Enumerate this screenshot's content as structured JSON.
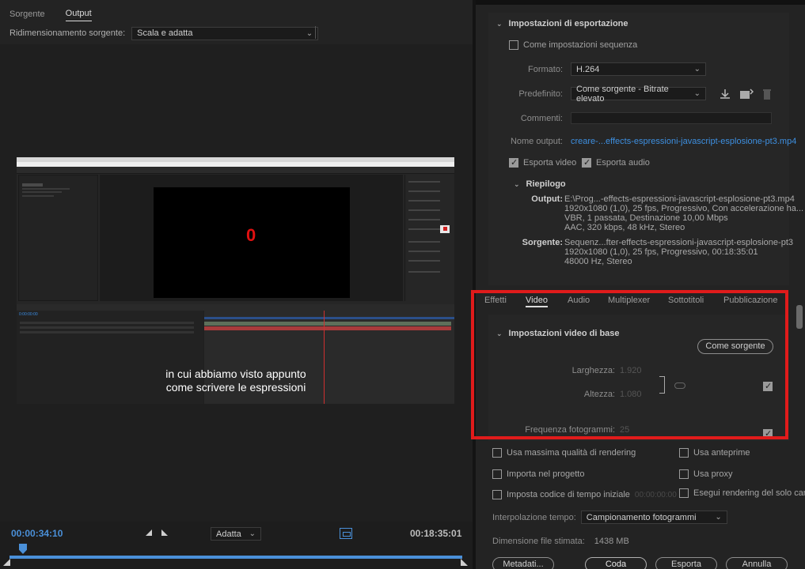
{
  "source_tabs": [
    {
      "label": "Sorgente",
      "active": false
    },
    {
      "label": "Output",
      "active": true
    }
  ],
  "resize": {
    "label": "Ridimensionamento sorgente:",
    "value": "Scala e adatta"
  },
  "preview": {
    "comp_value": "0",
    "timecode": "0:00:00:00",
    "subtitle_line1": "in cui abbiamo visto appunto",
    "subtitle_line2": "come scrivere le espressioni"
  },
  "playback": {
    "current_time": "00:00:34:10",
    "duration": "00:18:35:01",
    "fit_value": "Adatta"
  },
  "export": {
    "section_title": "Impostazioni di esportazione",
    "match_sequence_label": "Come impostazioni sequenza",
    "match_sequence_checked": false,
    "format_label": "Formato:",
    "format_value": "H.264",
    "preset_label": "Predefinito:",
    "preset_value": "Come sorgente - Bitrate elevato",
    "comments_label": "Commenti:",
    "comments_value": "",
    "output_name_label": "Nome output:",
    "output_name_value": "creare-...effects-espressioni-javascript-esplosione-pt3.mp4",
    "export_video_label": "Esporta video",
    "export_video_checked": true,
    "export_audio_label": "Esporta audio",
    "export_audio_checked": true,
    "summary_title": "Riepilogo",
    "summary_output_label": "Output:",
    "summary_output_lines": [
      "E:\\Prog...-effects-espressioni-javascript-esplosione-pt3.mp4",
      "1920x1080 (1,0), 25 fps, Progressivo, Con accelerazione ha...",
      "VBR, 1 passata, Destinazione 10,00 Mbps",
      "AAC, 320 kbps, 48 kHz, Stereo"
    ],
    "summary_source_label": "Sorgente:",
    "summary_source_lines": [
      "Sequenz...fter-effects-espressioni-javascript-esplosione-pt3",
      "1920x1080 (1,0), 25 fps, Progressivo, 00:18:35:01",
      "48000 Hz, Stereo"
    ]
  },
  "settings_tabs": [
    {
      "label": "Effetti",
      "active": false
    },
    {
      "label": "Video",
      "active": true
    },
    {
      "label": "Audio",
      "active": false
    },
    {
      "label": "Multiplexer",
      "active": false
    },
    {
      "label": "Sottotitoli",
      "active": false
    },
    {
      "label": "Pubblicazione",
      "active": false
    }
  ],
  "video": {
    "section_title": "Impostazioni video di base",
    "match_source_button": "Come sorgente",
    "width_label": "Larghezza:",
    "width_value": "1.920",
    "height_label": "Altezza:",
    "height_value": "1.080",
    "framerate_label": "Frequenza fotogrammi:",
    "framerate_value": "25"
  },
  "options": {
    "max_quality_label": "Usa massima qualità di rendering",
    "use_previews_label": "Usa anteprime",
    "import_project_label": "Importa nel progetto",
    "use_proxy_label": "Usa proxy",
    "set_start_tc_label": "Imposta codice di tempo iniziale",
    "start_tc_value": "00:00:00:00",
    "render_alpha_label": "Esegui rendering del solo canale",
    "interpolation_label": "Interpolazione tempo:",
    "interpolation_value": "Campionamento fotogrammi",
    "filesize_label": "Dimensione file stimata:",
    "filesize_value": "1438 MB"
  },
  "buttons": {
    "metadata": "Metadati...",
    "queue": "Coda",
    "export": "Esporta",
    "cancel": "Annulla"
  },
  "colors": {
    "accent_blue": "#3d8fe0",
    "highlight_red": "#e01b1b"
  }
}
